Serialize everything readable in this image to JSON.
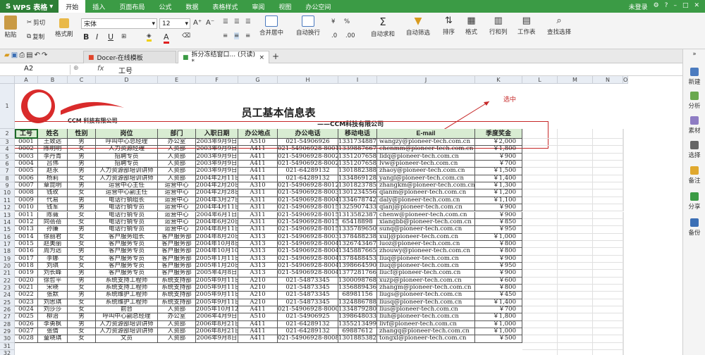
{
  "app": {
    "name": "WPS 表格",
    "tabs": [
      "开始",
      "插入",
      "页面布局",
      "公式",
      "数据",
      "表格样式",
      "审阅",
      "视图",
      "办公空间"
    ],
    "active_tab": 0,
    "status_right": "未登录"
  },
  "toolbar": {
    "paste": "粘贴",
    "cut": "剪切",
    "copy": "复制",
    "format_painter": "格式刷",
    "font": "宋体",
    "font_size": "12",
    "bold": "B",
    "italic": "I",
    "underline": "U",
    "merge": "合并居中",
    "wrap": "自动换行",
    "autosum": "自动求和",
    "filter": "自动筛选",
    "sort": "排序",
    "format": "格式",
    "rowcol": "行和列",
    "sheet": "工作表",
    "find": "查找选择",
    "percent": "%"
  },
  "doc_tabs": [
    "Docer-在线模板",
    "拆分冻结窗口... (只读) *"
  ],
  "formula_bar": {
    "cell_ref": "A2",
    "fx": "fx",
    "value": "工号"
  },
  "right_panel": [
    "新建",
    "分析",
    "素材",
    "选择",
    "备注",
    "分享",
    "备份"
  ],
  "columns": [
    "A",
    "B",
    "C",
    "D",
    "E",
    "F",
    "G",
    "H",
    "I",
    "J",
    "K",
    "L",
    "M",
    "N",
    "O"
  ],
  "sheet": {
    "title": "员工基本信息表",
    "subtitle": "——CCM科技有限公司",
    "logo_text": "CCM 科技有限公司",
    "annotation": "选中",
    "headers": [
      "工号",
      "姓名",
      "性别",
      "岗位",
      "部门",
      "入职日期",
      "办公地点",
      "办公电话",
      "移动电话",
      "E-mail",
      "季度奖金"
    ],
    "rows": [
      [
        "0001",
        "王致远",
        "男",
        "呼叫中心总经理",
        "办公室",
        "2003年9月9日",
        "A510",
        "021-54906926",
        "13317348876",
        "wangzy@pioneer-tech.com.cn",
        "￥2,000"
      ],
      [
        "0002",
        "陈明明",
        "女",
        "人力资源经理",
        "人资部",
        "2003年9月9日",
        "A411",
        "021-54906928-8001",
        "13398876678",
        "chenmm@pioneer-tech.com.cn",
        "￥1,800"
      ],
      [
        "0003",
        "李丹青",
        "男",
        "招聘专员",
        "人资部",
        "2003年9月9日",
        "A411",
        "021-54906928-8002",
        "13512076589",
        "lidq@pioneer-tech.com.cn",
        "￥900"
      ],
      [
        "0004",
        "吕伟",
        "男",
        "招聘专员",
        "人资部",
        "2003年9月9日",
        "A411",
        "021-54906928-8002",
        "13512076583",
        "lvw@pioneer-tech.com.cn",
        "￥700"
      ],
      [
        "0005",
        "赵永",
        "男",
        "人力资源部培训讲师",
        "人资部",
        "2003年9月9日",
        "A411",
        "021-64289132",
        "13018823888",
        "zhaoy@pioneer-tech.com.cn",
        "￥1,500"
      ],
      [
        "0006",
        "杨莉",
        "女",
        "人力资源部培训讲师",
        "人资部",
        "2004年2月11日",
        "A411",
        "021-64289132",
        "13348691286",
        "yangl@pioneer-tech.com.cn",
        "￥1,400"
      ],
      [
        "0007",
        "章昆明",
        "男",
        "运营中心主任",
        "运营中心",
        "2004年2月20日",
        "A310",
        "021-54906928-8012",
        "13018237858",
        "zhangkm@pioneer-tech.com.cn",
        "￥1,300"
      ],
      [
        "0008",
        "钱玫",
        "女",
        "运营中心副主任",
        "运营中心",
        "2004年2月28日",
        "A311",
        "021-54906928-8003",
        "13012345568",
        "qianm@pioneer-tech.com.cn",
        "￥1,200"
      ],
      [
        "0009",
        "代易",
        "男",
        "电话行销组长",
        "运营中心",
        "2004年3月27日",
        "A311",
        "021-54906928-8004",
        "13346787422",
        "daiy@pioneer-tech.com.cn",
        "￥1,100"
      ],
      [
        "0010",
        "钱军",
        "男",
        "电话行销专员",
        "运营中心",
        "2004年4月11日",
        "A311",
        "021-54906928-8015",
        "13259074338",
        "qianj@pioneer-tech.com.cn",
        "￥900"
      ],
      [
        "0011",
        "陈薇",
        "女",
        "电话行销专员",
        "运营中心",
        "2004年6月1日",
        "A311",
        "021-54906928-8015",
        "13135823870",
        "chenw@pioneer-tech.com.cn",
        "￥900"
      ],
      [
        "0012",
        "向蓓蓓",
        "女",
        "电话行销专员",
        "运营中心",
        "2004年6月20日",
        "A311",
        "021-54906928-8015",
        "65418898",
        "xiangbb@pioneer-tech.com.cn",
        "￥850"
      ],
      [
        "0013",
        "孙廉",
        "男",
        "电话行销专员",
        "运营中心",
        "2004年8月11日",
        "A311",
        "021-54906928-8015",
        "13357896502",
        "sunq@pioneer-tech.com.cn",
        "￥950"
      ],
      [
        "0014",
        "徐丽君",
        "女",
        "客户服务组长",
        "客户服务部",
        "2004年8月20日",
        "A313",
        "021-54906928-8003",
        "13784882386",
        "xulj@pioneer-tech.com.cn",
        "￥1,000"
      ],
      [
        "0015",
        "赵美丽",
        "女",
        "客户服务专员",
        "客户服务部",
        "2004年10月8日",
        "A313",
        "021-54906928-8004",
        "13267434678",
        "luoz@pioneer-tech.com.cn",
        "￥800"
      ],
      [
        "0016",
        "周为远",
        "男",
        "客户服务专员",
        "客户服务部",
        "2004年10月10日",
        "A313",
        "021-54906928-8004",
        "13458876656",
        "zhouwy@pioneer-tech.com.cn",
        "￥800"
      ],
      [
        "0017",
        "李娜",
        "女",
        "客户服务专员",
        "客户服务部",
        "2005年1月11日",
        "A313",
        "021-54906928-8004",
        "13784884532",
        "liuq@pioneer-tech.com.cn",
        "￥900"
      ],
      [
        "0018",
        "刘琪",
        "女",
        "客户服务专员",
        "客户服务部",
        "2005年1月20日",
        "A313",
        "021-54906928-8004",
        "13986645902",
        "liuq@pioneer-tech.com.cn",
        "￥950"
      ],
      [
        "0019",
        "刘长峰",
        "男",
        "客户服务专员",
        "客户服务部",
        "2005年4月8日",
        "A313",
        "021-54906928-8004",
        "13772817665",
        "liucf@pioneer-tech.com.cn",
        "￥900"
      ],
      [
        "0020",
        "徐哲平",
        "男",
        "系统支持工程师",
        "系统支持部",
        "2005年9月11日",
        "A210",
        "021-54873345",
        "13000987685",
        "xuzp@pioneer-tech.com.cn",
        "￥600"
      ],
      [
        "0021",
        "宋晓",
        "女",
        "系统支持工程师",
        "系统支持部",
        "2005年9月11日",
        "A210",
        "021-54873345",
        "13568894365",
        "zhangm@pioneer-tech.com.cn",
        "￥800"
      ],
      [
        "0022",
        "张默",
        "男",
        "系统维护工程师",
        "系统支持部",
        "2005年9月11日",
        "A210",
        "021-54873345",
        "68981156",
        "liugs@pioneer-tech.com.cn",
        "￥450"
      ],
      [
        "0023",
        "刘思琪",
        "女",
        "系统维护工程师",
        "系统支持部",
        "2005年9月11日",
        "A210",
        "021-54873345",
        "13248867889",
        "liusq@pioneer-tech.com.cn",
        "￥1,400"
      ],
      [
        "0024",
        "刘莎莎",
        "女",
        "前台",
        "人资部",
        "2005年10月12日",
        "A411",
        "021-54906928-8000",
        "13348792808",
        "lius@pioneer-tech.com.cn",
        "￥700"
      ],
      [
        "0025",
        "柳治",
        "男",
        "呼叫中心副总经理",
        "办公室",
        "2006年4月9日",
        "A510",
        "021-54906925",
        "13986480332",
        "liuh@pioneer-tech.com.cn",
        "￥1,800"
      ],
      [
        "0026",
        "李勇枫",
        "男",
        "人力资源部培训讲师",
        "人资部",
        "2006年8月21日",
        "A411",
        "021-64289132",
        "13552134998",
        "livf@pioneer-tech.com.cn",
        "￥1,000"
      ],
      [
        "0027",
        "张倩",
        "女",
        "人力资源部培训讲师",
        "人资部",
        "2006年8月21日",
        "A411",
        "021-64289132",
        "69887612",
        "zhangq@pioneer-tech.com.cn",
        "￥1,000"
      ],
      [
        "0028",
        "童晓琪",
        "女",
        "文员",
        "人资部",
        "2006年9月8日",
        "A411",
        "021-54906928-8008",
        "13018853823",
        "tongxl@pioneer-tech.com.cn",
        "￥500"
      ]
    ]
  },
  "colors": {
    "menubar": "#3b9b45",
    "accent": "#2d7f36",
    "annotation": "#c62828",
    "table_header": "#d8ecd2"
  }
}
